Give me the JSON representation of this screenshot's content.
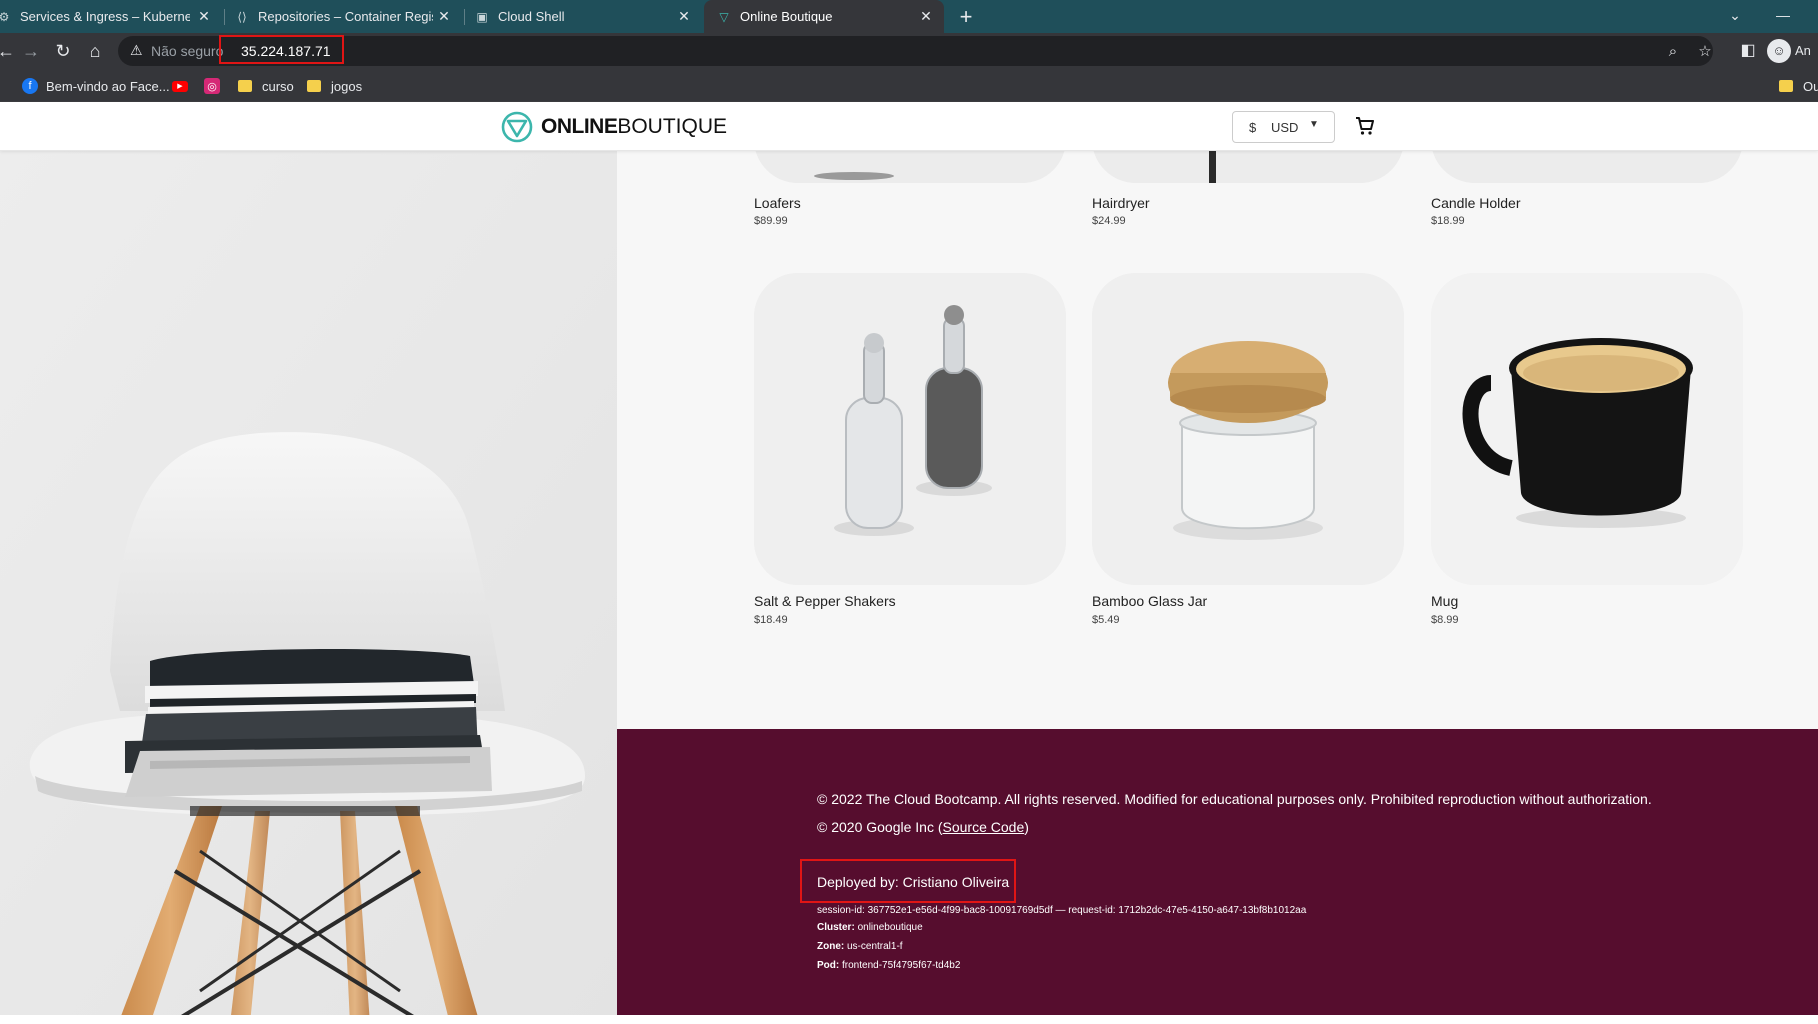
{
  "browser": {
    "tabs": [
      {
        "title": "Services & Ingress – Kubernetes",
        "active": false
      },
      {
        "title": "Repositories – Container Registry",
        "active": false
      },
      {
        "title": "Cloud Shell",
        "active": false
      },
      {
        "title": "Online Boutique",
        "active": true
      }
    ],
    "address": {
      "security_label": "Não seguro",
      "url": "35.224.187.71"
    },
    "profile_label": "An",
    "bookmarks": [
      {
        "label": "Bem-vindo ao Face..."
      },
      {
        "label": "curso"
      },
      {
        "label": "jogos"
      },
      {
        "label": "Ou"
      }
    ]
  },
  "site": {
    "logo_bold": "ONLINE",
    "logo_light": "BOUTIQUE",
    "currency_symbol": "$",
    "currency_code": "USD"
  },
  "products_row1": [
    {
      "name": "Loafers",
      "price": "$89.99"
    },
    {
      "name": "Hairdryer",
      "price": "$24.99"
    },
    {
      "name": "Candle Holder",
      "price": "$18.99"
    }
  ],
  "products_row2": [
    {
      "name": "Salt & Pepper Shakers",
      "price": "$18.49"
    },
    {
      "name": "Bamboo Glass Jar",
      "price": "$5.49"
    },
    {
      "name": "Mug",
      "price": "$8.99"
    }
  ],
  "footer": {
    "copyright": "© 2022 The Cloud Bootcamp. All rights reserved. Modified for educational purposes only. Prohibited reproduction without authorization.",
    "google_prefix": "© 2020 Google Inc (",
    "source_link": "Source Code",
    "google_suffix": ")",
    "deployed_by": "Deployed by: Cristiano Oliveira",
    "session_line": "session-id: 367752e1-e56d-4f99-bac8-10091769d5df — request-id: 1712b2dc-47e5-4150-a647-13bf8b1012aa",
    "cluster_label": "Cluster:",
    "cluster_value": "onlineboutique",
    "zone_label": "Zone:",
    "zone_value": "us-central1-f",
    "pod_label": "Pod:",
    "pod_value": "frontend-75f4795f67-td4b2"
  },
  "colors": {
    "footer_bg": "#560d2e",
    "tab_strip": "#1f4f5a",
    "highlight": "#e01515",
    "logo_teal": "#3cb6ac"
  }
}
